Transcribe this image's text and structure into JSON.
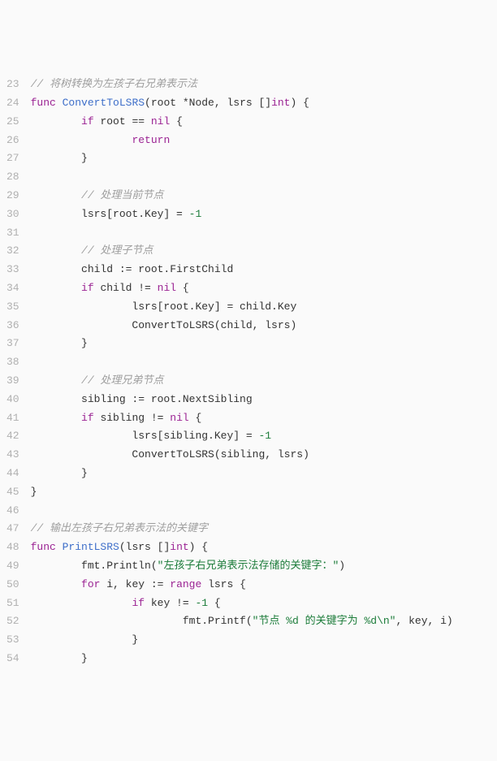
{
  "startLine": 23,
  "lines": [
    [
      {
        "t": "// 将树转换为左孩子右兄弟表示法",
        "c": "tok-comment"
      }
    ],
    [
      {
        "t": "func ",
        "c": "tok-keyword"
      },
      {
        "t": "ConvertToLSRS",
        "c": "tok-funcname"
      },
      {
        "t": "(root *Node, lsrs []",
        "c": "tok-ident"
      },
      {
        "t": "int",
        "c": "tok-type"
      },
      {
        "t": ") {",
        "c": "tok-ident"
      }
    ],
    [
      {
        "t": "        ",
        "c": ""
      },
      {
        "t": "if",
        "c": "tok-keyword"
      },
      {
        "t": " root == ",
        "c": "tok-ident"
      },
      {
        "t": "nil",
        "c": "tok-builtin"
      },
      {
        "t": " {",
        "c": "tok-ident"
      }
    ],
    [
      {
        "t": "                ",
        "c": ""
      },
      {
        "t": "return",
        "c": "tok-keyword"
      }
    ],
    [
      {
        "t": "        }",
        "c": "tok-ident"
      }
    ],
    [
      {
        "t": "",
        "c": ""
      }
    ],
    [
      {
        "t": "        ",
        "c": ""
      },
      {
        "t": "// 处理当前节点",
        "c": "tok-comment"
      }
    ],
    [
      {
        "t": "        lsrs[root.Key] = ",
        "c": "tok-ident"
      },
      {
        "t": "-1",
        "c": "tok-number"
      }
    ],
    [
      {
        "t": "",
        "c": ""
      }
    ],
    [
      {
        "t": "        ",
        "c": ""
      },
      {
        "t": "// 处理子节点",
        "c": "tok-comment"
      }
    ],
    [
      {
        "t": "        child := root.FirstChild",
        "c": "tok-ident"
      }
    ],
    [
      {
        "t": "        ",
        "c": ""
      },
      {
        "t": "if",
        "c": "tok-keyword"
      },
      {
        "t": " child != ",
        "c": "tok-ident"
      },
      {
        "t": "nil",
        "c": "tok-builtin"
      },
      {
        "t": " {",
        "c": "tok-ident"
      }
    ],
    [
      {
        "t": "                lsrs[root.Key] = child.Key",
        "c": "tok-ident"
      }
    ],
    [
      {
        "t": "                ConvertToLSRS(child, lsrs)",
        "c": "tok-ident"
      }
    ],
    [
      {
        "t": "        }",
        "c": "tok-ident"
      }
    ],
    [
      {
        "t": "",
        "c": ""
      }
    ],
    [
      {
        "t": "        ",
        "c": ""
      },
      {
        "t": "// 处理兄弟节点",
        "c": "tok-comment"
      }
    ],
    [
      {
        "t": "        sibling := root.NextSibling",
        "c": "tok-ident"
      }
    ],
    [
      {
        "t": "        ",
        "c": ""
      },
      {
        "t": "if",
        "c": "tok-keyword"
      },
      {
        "t": " sibling != ",
        "c": "tok-ident"
      },
      {
        "t": "nil",
        "c": "tok-builtin"
      },
      {
        "t": " {",
        "c": "tok-ident"
      }
    ],
    [
      {
        "t": "                lsrs[sibling.Key] = ",
        "c": "tok-ident"
      },
      {
        "t": "-1",
        "c": "tok-number"
      }
    ],
    [
      {
        "t": "                ConvertToLSRS(sibling, lsrs)",
        "c": "tok-ident"
      }
    ],
    [
      {
        "t": "        }",
        "c": "tok-ident"
      }
    ],
    [
      {
        "t": "}",
        "c": "tok-ident"
      }
    ],
    [
      {
        "t": "",
        "c": ""
      }
    ],
    [
      {
        "t": "// 输出左孩子右兄弟表示法的关键字",
        "c": "tok-comment"
      }
    ],
    [
      {
        "t": "func ",
        "c": "tok-keyword"
      },
      {
        "t": "PrintLSRS",
        "c": "tok-funcname"
      },
      {
        "t": "(lsrs []",
        "c": "tok-ident"
      },
      {
        "t": "int",
        "c": "tok-type"
      },
      {
        "t": ") {",
        "c": "tok-ident"
      }
    ],
    [
      {
        "t": "        fmt.Println(",
        "c": "tok-ident"
      },
      {
        "t": "\"左孩子右兄弟表示法存储的关键字：\"",
        "c": "tok-string"
      },
      {
        "t": ")",
        "c": "tok-ident"
      }
    ],
    [
      {
        "t": "        ",
        "c": ""
      },
      {
        "t": "for",
        "c": "tok-keyword"
      },
      {
        "t": " i, key := ",
        "c": "tok-ident"
      },
      {
        "t": "range",
        "c": "tok-keyword"
      },
      {
        "t": " lsrs {",
        "c": "tok-ident"
      }
    ],
    [
      {
        "t": "                ",
        "c": ""
      },
      {
        "t": "if",
        "c": "tok-keyword"
      },
      {
        "t": " key != ",
        "c": "tok-ident"
      },
      {
        "t": "-1",
        "c": "tok-number"
      },
      {
        "t": " {",
        "c": "tok-ident"
      }
    ],
    [
      {
        "t": "                        fmt.Printf(",
        "c": "tok-ident"
      },
      {
        "t": "\"节点 %d 的关键字为 %d\\n\"",
        "c": "tok-string"
      },
      {
        "t": ", key, i)",
        "c": "tok-ident"
      }
    ],
    [
      {
        "t": "                }",
        "c": "tok-ident"
      }
    ],
    [
      {
        "t": "        }",
        "c": "tok-ident"
      }
    ]
  ]
}
